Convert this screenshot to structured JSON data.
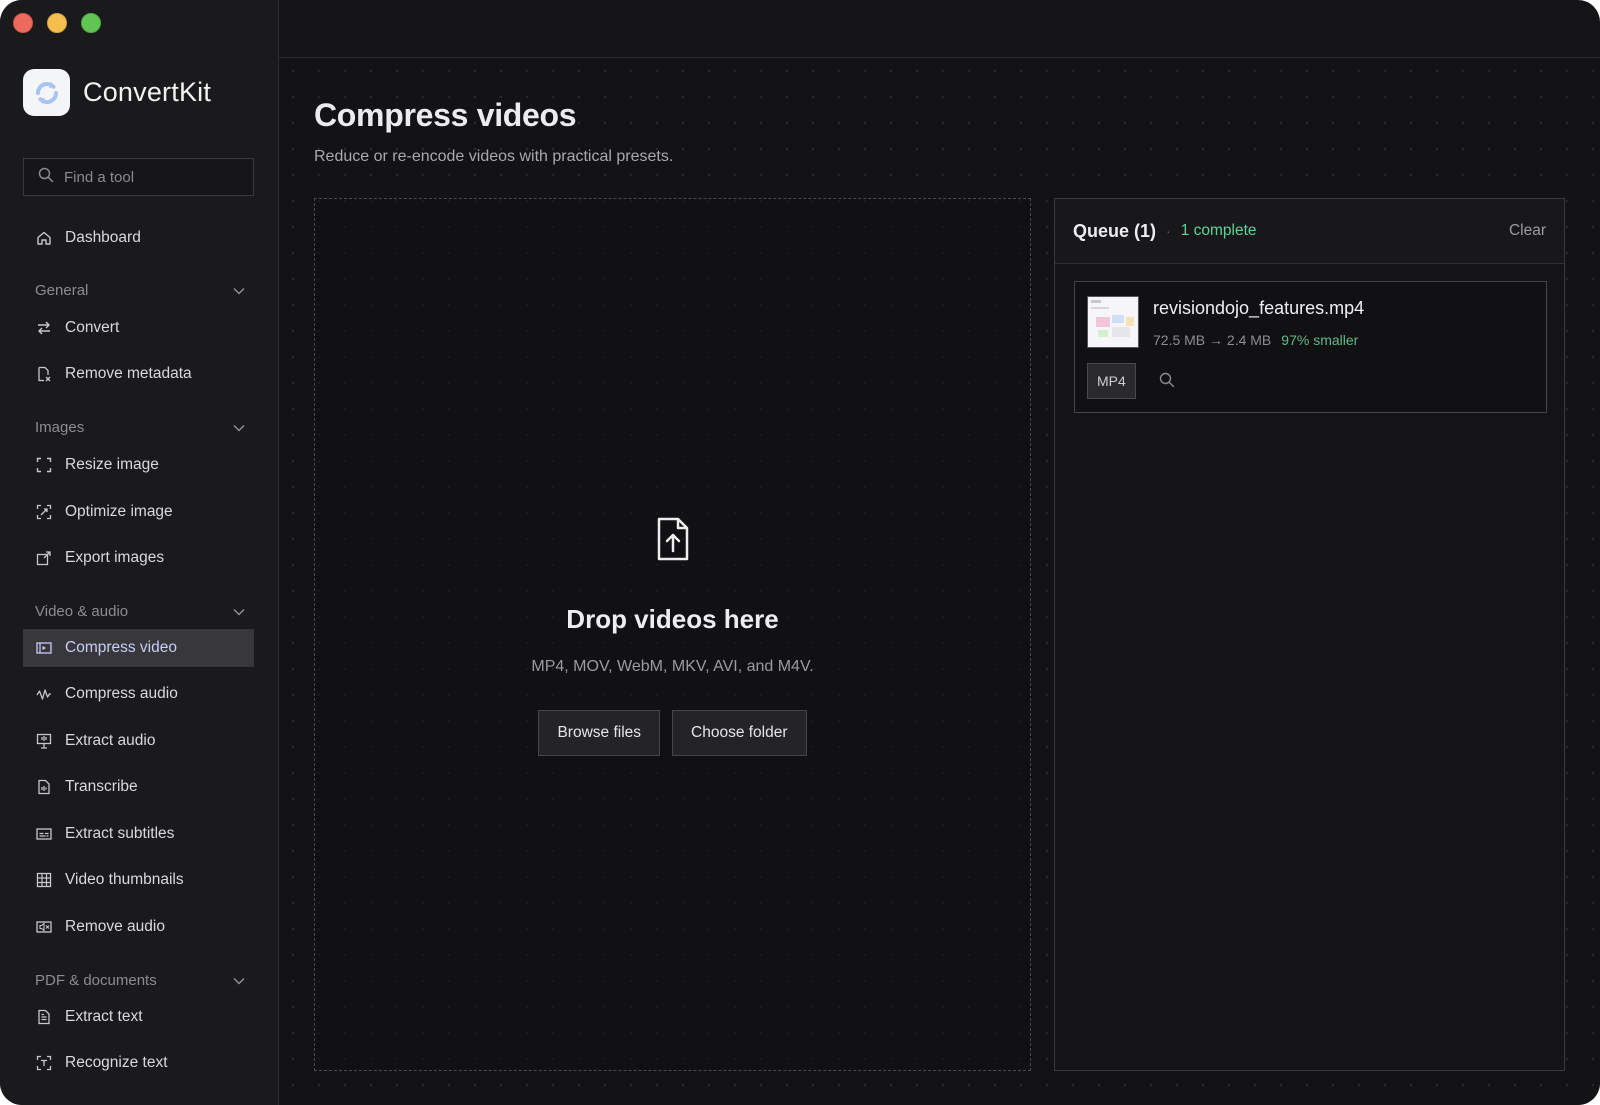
{
  "app": {
    "name": "ConvertKit"
  },
  "sidebar": {
    "search_placeholder": "Find a tool",
    "dashboard": "Dashboard",
    "sections": [
      {
        "label": "General",
        "items": [
          "Convert",
          "Remove metadata"
        ]
      },
      {
        "label": "Images",
        "items": [
          "Resize image",
          "Optimize image",
          "Export images"
        ]
      },
      {
        "label": "Video & audio",
        "items": [
          "Compress video",
          "Compress audio",
          "Extract audio",
          "Transcribe",
          "Extract subtitles",
          "Video thumbnails",
          "Remove audio"
        ]
      },
      {
        "label": "PDF & documents",
        "items": [
          "Extract text",
          "Recognize text"
        ]
      }
    ],
    "active_item": "Compress video"
  },
  "main": {
    "title": "Compress videos",
    "subtitle": "Reduce or re-encode videos with practical presets.",
    "dropzone": {
      "title": "Drop videos here",
      "formats": "MP4, MOV, WebM, MKV, AVI, and M4V.",
      "browse_label": "Browse files",
      "folder_label": "Choose folder"
    },
    "queue": {
      "title": "Queue (1)",
      "status": "1 complete",
      "clear_label": "Clear",
      "items": [
        {
          "name": "revisiondojo_features.mp4",
          "size": "72.5 MB → 2.4 MB",
          "saving": "97% smaller",
          "format": "MP4"
        }
      ]
    }
  },
  "colors": {
    "accent_green": "#5fd39a",
    "active_text": "#c9cdf7"
  }
}
